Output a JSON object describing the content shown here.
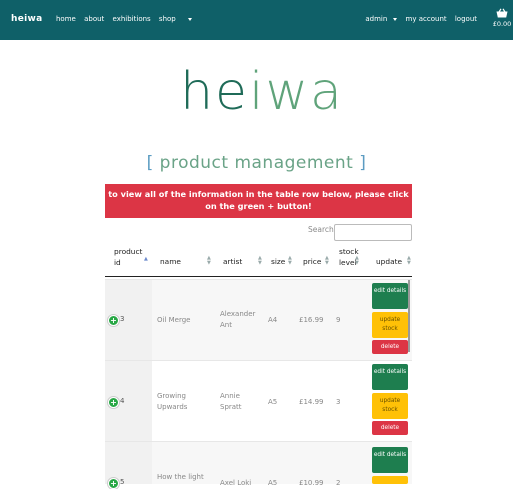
{
  "navbar": {
    "brand": "heiwa",
    "links": {
      "home": "home",
      "about": "about",
      "exhibitions": "exhibitions",
      "shop": "shop"
    },
    "right": {
      "admin": "admin",
      "account": "my account",
      "logout": "logout"
    },
    "basket_total": "£0.00",
    "colors": {
      "background": "#0f6068",
      "text": "#ffffff"
    }
  },
  "logo": {
    "part1": "he",
    "part2": "iwa"
  },
  "subtitle": {
    "open": "[",
    "w1": "product",
    "w2": "management",
    "close": "]"
  },
  "alert": {
    "text": "to view all of the information in the table row below, please click on the green + button!"
  },
  "search": {
    "label": "Search:",
    "value": ""
  },
  "table": {
    "headers": {
      "id": "product id",
      "name": "name",
      "artist": "artist",
      "size": "size",
      "price": "price",
      "stock": "stock level",
      "update": "update"
    },
    "rows": [
      {
        "id": "3",
        "name": "Oil Merge",
        "artist": "Alexander Ant",
        "size": "A4",
        "price": "£16.99",
        "stock": "9"
      },
      {
        "id": "4",
        "name": "Growing Upwards",
        "artist": "Annie Spratt",
        "size": "A5",
        "price": "£14.99",
        "stock": "3"
      },
      {
        "id": "5",
        "name": "How the light",
        "artist": "Axel Loki",
        "size": "A5",
        "price": "£10.99",
        "stock": "2"
      }
    ],
    "buttons": {
      "edit": "edit details",
      "update": "update stock",
      "delete": "delete"
    }
  },
  "colors": {
    "accent_green": "#28a745",
    "alert_red": "#dc3545",
    "warning_yellow": "#ffc107",
    "dark_green": "#1e7e4f"
  }
}
